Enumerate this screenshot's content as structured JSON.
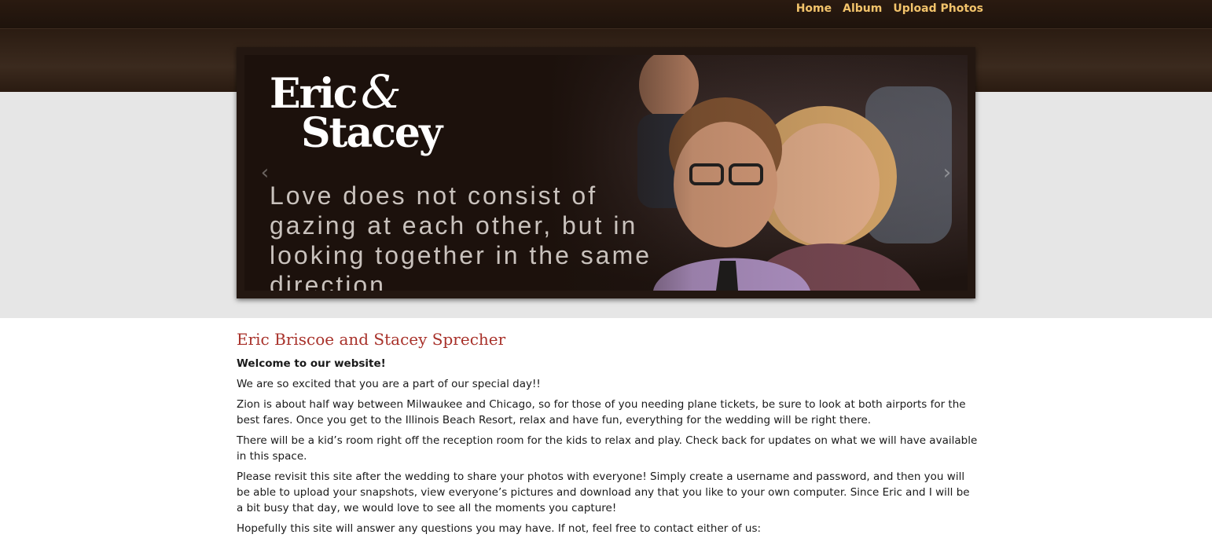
{
  "nav": {
    "items": [
      {
        "label": "Home"
      },
      {
        "label": "Album"
      },
      {
        "label": "Upload Photos"
      }
    ]
  },
  "banner": {
    "logo_line1": "Eric",
    "logo_amp": "&",
    "logo_line2": "Stacey",
    "quote": "Love does not consist of gazing at each other, but in looking together in the same direction.",
    "prev_icon": "‹",
    "next_icon": "›"
  },
  "content": {
    "title": "Eric Briscoe and Stacey Sprecher",
    "welcome": "Welcome to our website!",
    "paragraphs": [
      "We are so excited that you are a part of our special day!!",
      "Zion is about half way between Milwaukee and Chicago, so for those of you needing plane tickets, be sure to look at both airports for the best fares. Once you get to the Illinois Beach Resort, relax and have fun, everything for the wedding will be right there.",
      "There will be a kid’s room right off the reception room for the kids to relax and play. Check back for updates on what we will have available in this space.",
      "Please revisit this site after the wedding to share your photos with everyone! Simply create a username and password, and then you will be able to upload your snapshots, view everyone’s pictures and download any that you like to your own computer. Since Eric and I will be a bit busy that day, we would love to see all the moments you capture!",
      "Hopefully this site will answer any questions you may have. If not, feel free to contact either of us:"
    ]
  },
  "colors": {
    "nav_link": "#f2c36b",
    "title": "#a8312a",
    "header": "#2b1c12"
  }
}
